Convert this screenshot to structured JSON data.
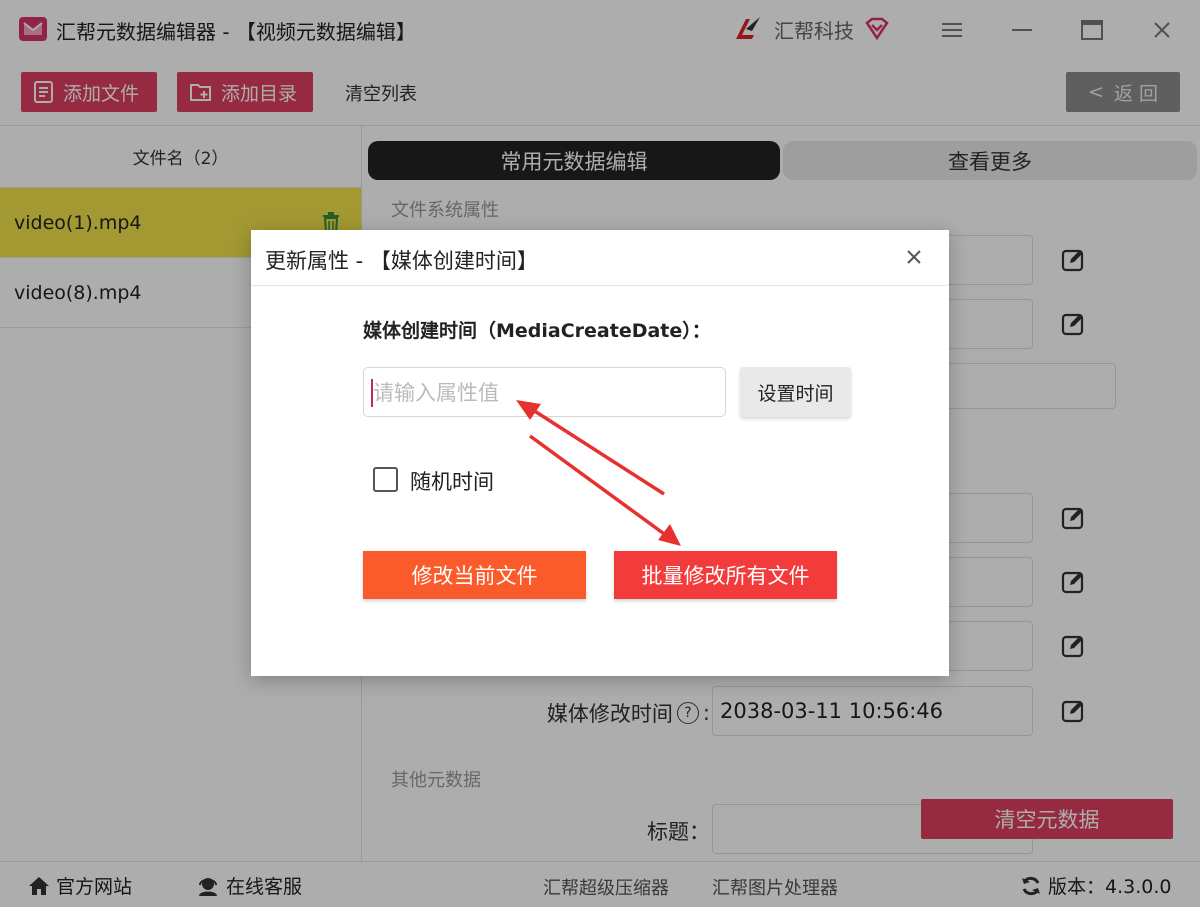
{
  "window": {
    "title": "汇帮元数据编辑器 - 【视频元数据编辑】",
    "brand_name": "汇帮科技"
  },
  "toolbar": {
    "add_file": "添加文件",
    "add_dir": "添加目录",
    "clear_list": "清空列表",
    "back": "返 回"
  },
  "file_list": {
    "header": "文件名（2）",
    "items": [
      {
        "name": "video(1).mp4",
        "selected": true
      },
      {
        "name": "video(8).mp4",
        "selected": false
      }
    ]
  },
  "tabs": {
    "common": "常用元数据编辑",
    "more": "查看更多"
  },
  "sections": {
    "fs_props": "文件系统属性",
    "other_meta": "其他元数据"
  },
  "fields": {
    "media_modify_label": "媒体修改时间",
    "media_modify_value": "2038-03-11 10:56:46",
    "title_label": "标题："
  },
  "clear_metadata": "清空元数据",
  "statusbar": {
    "website": "官方网站",
    "support": "在线客服",
    "link1": "汇帮超级压缩器",
    "link2": "汇帮图片处理器",
    "version": "版本：4.3.0.0"
  },
  "dialog": {
    "title": "更新属性 - 【媒体创建时间】",
    "field_label": "媒体创建时间（MediaCreateDate）：",
    "input_placeholder": "请输入属性值",
    "set_time": "设置时间",
    "random_time": "随机时间",
    "random_checked": false,
    "modify_current": "修改当前文件",
    "modify_all": "批量修改所有文件"
  },
  "colors": {
    "accent_pink": "#de3f61",
    "selected_row": "#f0e24a",
    "btn_orange": "#fb5a2a",
    "btn_red": "#f23b3b",
    "annotation_arrow": "#e8312f"
  }
}
